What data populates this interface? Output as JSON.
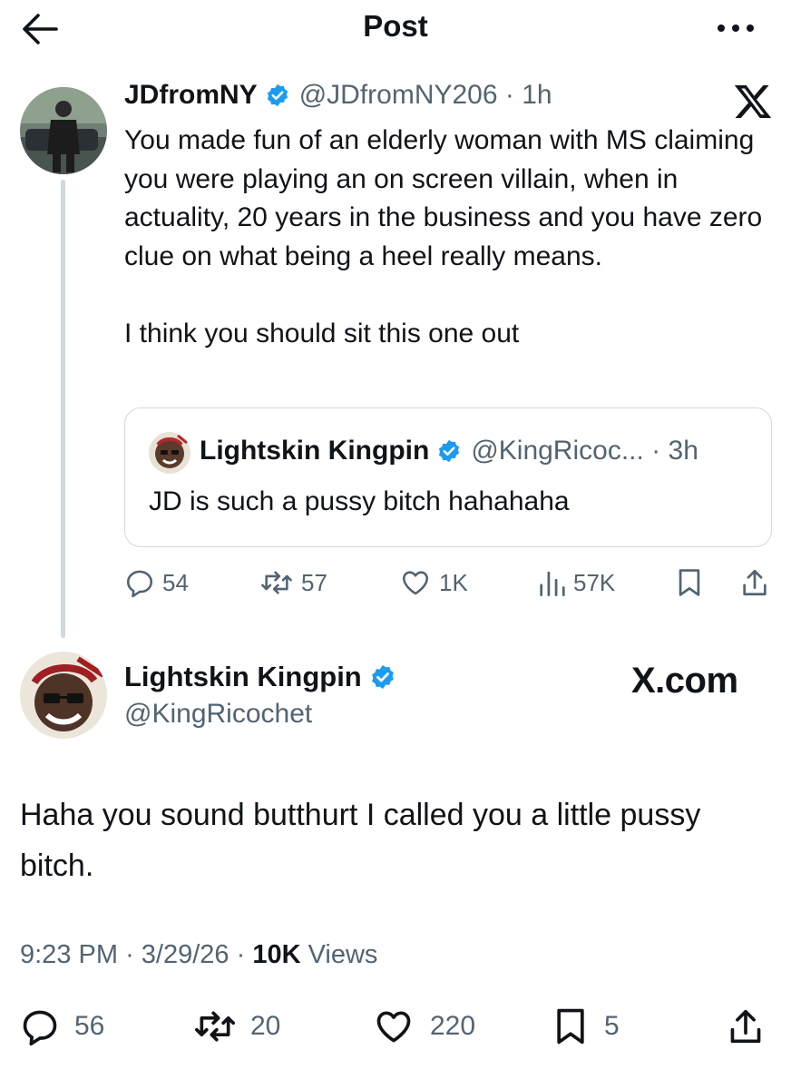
{
  "header": {
    "title": "Post"
  },
  "parent_tweet": {
    "name": "JDfromNY",
    "handle": "@JDfromNY206",
    "time": "1h",
    "text": "You made fun of an elderly woman with MS claiming you were playing an on screen villain, when in actuality, 20 years in the business and you have zero clue on what being a heel really means.\n\nI think you should sit this one out",
    "quoted": {
      "name": "Lightskin Kingpin",
      "handle": "@KingRicoc...",
      "time": "3h",
      "text": "JD is such a pussy bitch hahahaha"
    },
    "stats": {
      "replies": "54",
      "reposts": "57",
      "likes": "1K",
      "views": "57K"
    }
  },
  "main_tweet": {
    "name": "Lightskin Kingpin",
    "handle": "@KingRicochet",
    "text": "Haha you sound butthurt I called you a little pussy bitch.",
    "time": "9:23 PM",
    "date": "3/29/26",
    "views_count": "10K",
    "views_label": "Views",
    "stats": {
      "replies": "56",
      "reposts": "20",
      "likes": "220",
      "bookmarks": "5"
    }
  },
  "watermark": "X.com",
  "icons": [
    "back-arrow-icon",
    "more-icon",
    "verified-badge-icon",
    "x-logo-icon",
    "reply-icon",
    "repost-icon",
    "like-icon",
    "views-icon",
    "bookmark-icon",
    "share-icon"
  ],
  "colors": {
    "verified": "#1d9bf0",
    "muted": "#536471",
    "text": "#0f1419",
    "border": "#cfd9de"
  }
}
